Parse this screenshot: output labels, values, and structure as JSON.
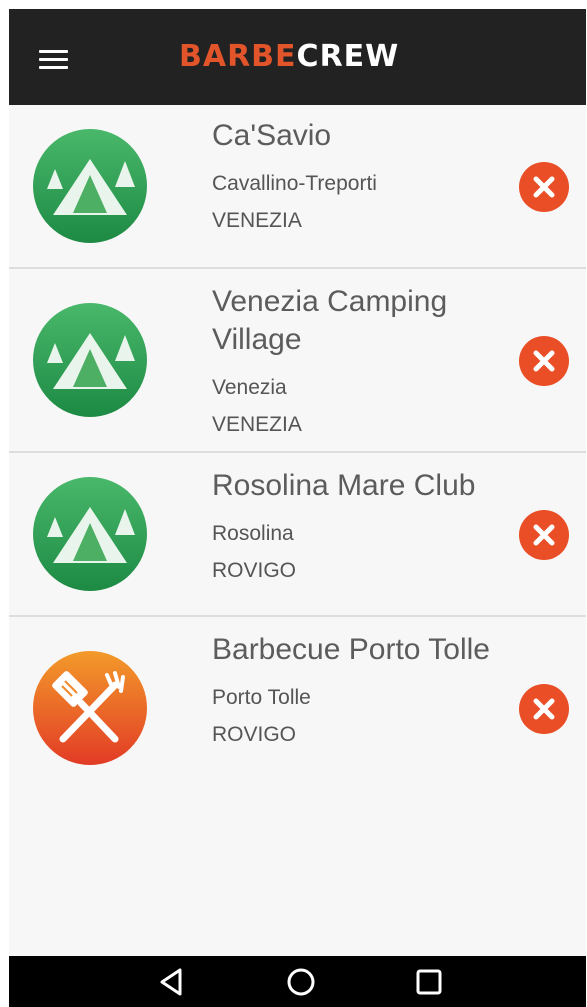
{
  "app": {
    "logo_part1": "BARBE",
    "logo_part2": "CREW",
    "accent": "#e2542a"
  },
  "items": [
    {
      "name": "Ca'Savio",
      "city": "Cavallino-Treporti",
      "province": "VENEZIA",
      "icon": "camping-tent-icon"
    },
    {
      "name": "Venezia Camping Village",
      "city": "Venezia",
      "province": "VENEZIA",
      "icon": "camping-tent-icon"
    },
    {
      "name": "Rosolina Mare Club",
      "city": "Rosolina",
      "province": "ROVIGO",
      "icon": "camping-tent-icon"
    },
    {
      "name": "Barbecue Porto Tolle",
      "city": "Porto Tolle",
      "province": "ROVIGO",
      "icon": "barbecue-tools-icon"
    }
  ],
  "icons": {
    "menu": "hamburger-menu-icon",
    "delete": "close-circle-icon",
    "nav_back": "back-triangle-icon",
    "nav_home": "home-circle-icon",
    "nav_recents": "recents-square-icon"
  }
}
